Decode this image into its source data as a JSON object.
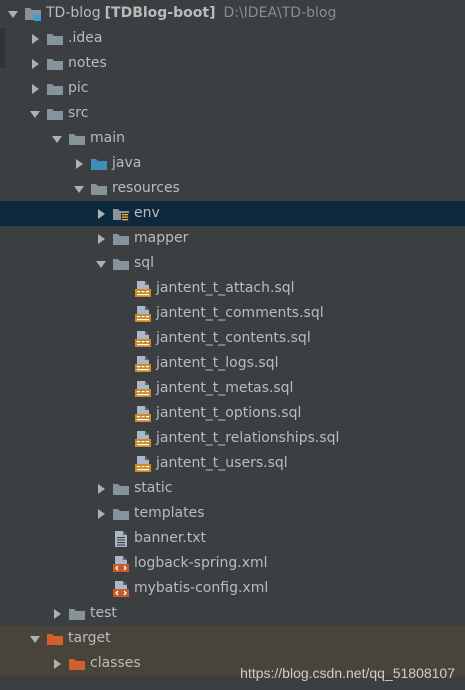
{
  "project": {
    "name": "TD-blog",
    "module": "[TDBlog-boot]",
    "path": "D:\\IDEA\\TD-blog"
  },
  "items": [
    {
      "label": "TD-blog",
      "depth": 0,
      "type": "project",
      "expanded": true
    },
    {
      "label": ".idea",
      "depth": 1,
      "type": "folder",
      "expanded": false
    },
    {
      "label": "notes",
      "depth": 1,
      "type": "folder",
      "expanded": false
    },
    {
      "label": "pic",
      "depth": 1,
      "type": "folder",
      "expanded": false
    },
    {
      "label": "src",
      "depth": 1,
      "type": "folder",
      "expanded": true
    },
    {
      "label": "main",
      "depth": 2,
      "type": "folder",
      "expanded": true
    },
    {
      "label": "java",
      "depth": 3,
      "type": "source-folder",
      "expanded": false
    },
    {
      "label": "resources",
      "depth": 3,
      "type": "resources-folder",
      "expanded": true
    },
    {
      "label": "env",
      "depth": 4,
      "type": "env-folder",
      "expanded": false,
      "selected": true
    },
    {
      "label": "mapper",
      "depth": 4,
      "type": "folder",
      "expanded": false
    },
    {
      "label": "sql",
      "depth": 4,
      "type": "folder",
      "expanded": true
    },
    {
      "label": "jantent_t_attach.sql",
      "depth": 5,
      "type": "sql-file"
    },
    {
      "label": "jantent_t_comments.sql",
      "depth": 5,
      "type": "sql-file"
    },
    {
      "label": "jantent_t_contents.sql",
      "depth": 5,
      "type": "sql-file"
    },
    {
      "label": "jantent_t_logs.sql",
      "depth": 5,
      "type": "sql-file"
    },
    {
      "label": "jantent_t_metas.sql",
      "depth": 5,
      "type": "sql-file"
    },
    {
      "label": "jantent_t_options.sql",
      "depth": 5,
      "type": "sql-file"
    },
    {
      "label": "jantent_t_relationships.sql",
      "depth": 5,
      "type": "sql-file"
    },
    {
      "label": "jantent_t_users.sql",
      "depth": 5,
      "type": "sql-file"
    },
    {
      "label": "static",
      "depth": 4,
      "type": "folder",
      "expanded": false
    },
    {
      "label": "templates",
      "depth": 4,
      "type": "folder",
      "expanded": false
    },
    {
      "label": "banner.txt",
      "depth": 4,
      "type": "text-file"
    },
    {
      "label": "logback-spring.xml",
      "depth": 4,
      "type": "xml-file"
    },
    {
      "label": "mybatis-config.xml",
      "depth": 4,
      "type": "xml-file"
    },
    {
      "label": "test",
      "depth": 2,
      "type": "folder",
      "expanded": false
    },
    {
      "label": "target",
      "depth": 1,
      "type": "excluded-folder",
      "expanded": true,
      "excluded": true
    },
    {
      "label": "classes",
      "depth": 2,
      "type": "excluded-folder",
      "expanded": false,
      "excluded": true
    }
  ],
  "watermark": "https://blog.csdn.net/qq_51808107",
  "colors": {
    "background": "#3c3f41",
    "selected": "#0d293e",
    "excluded_row": "#48443b",
    "folder": "#87939a",
    "source_folder": "#3d8fb5",
    "excluded_folder": "#d1602d",
    "sql_badge": "#c98a2c",
    "xml_badge": "#c65a2a"
  }
}
